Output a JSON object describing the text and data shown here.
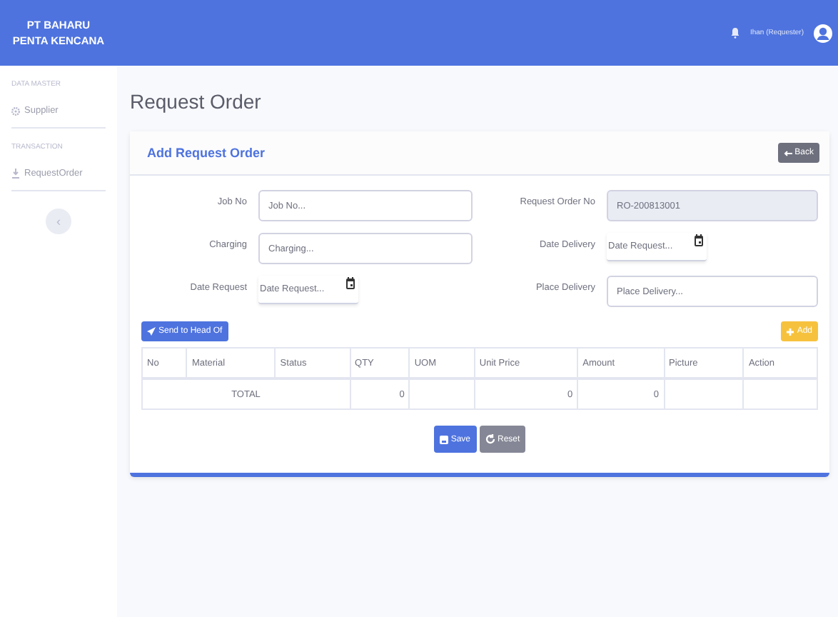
{
  "brand": {
    "line1": "PT BAHARU",
    "line2": "PENTA KENCANA"
  },
  "topbar": {
    "user": "Ihan (Requester)"
  },
  "sidebar": {
    "sections": [
      {
        "heading": "DATA MASTER",
        "items": [
          {
            "label": "Supplier",
            "kind": "gear"
          }
        ]
      },
      {
        "heading": "TRANSACTION",
        "items": [
          {
            "label": "RequestOrder",
            "kind": "download"
          }
        ]
      }
    ],
    "toggle": "‹"
  },
  "page_title": "Request Order",
  "card": {
    "title": "Add Request Order",
    "back_button": "Back",
    "fields": [
      {
        "label": "Job No",
        "kind": "text",
        "placeholder": "Job No..."
      },
      {
        "label": "Request Order No",
        "kind": "readonly",
        "value": "RO-200813001"
      },
      {
        "label": "Charging",
        "kind": "text",
        "placeholder": "Charging..."
      },
      {
        "label": "Date Delivery",
        "kind": "date",
        "placeholder": "Date Request..."
      },
      {
        "label": "Date Request",
        "kind": "date",
        "placeholder": "Date Request..."
      },
      {
        "label": "Place Delivery",
        "kind": "text",
        "placeholder": "Place Delivery..."
      }
    ],
    "send_button": "Send to Head Of",
    "add_button": "Add",
    "table": {
      "columns": [
        "No",
        "Material",
        "Status",
        "QTY",
        "UOM",
        "Unit Price",
        "Amount",
        "Picture",
        "Action"
      ],
      "total": {
        "label": "TOTAL",
        "qty": "0",
        "unit_price": "0",
        "amount": "0"
      }
    },
    "save_button": "Save",
    "reset_button": "Reset"
  }
}
